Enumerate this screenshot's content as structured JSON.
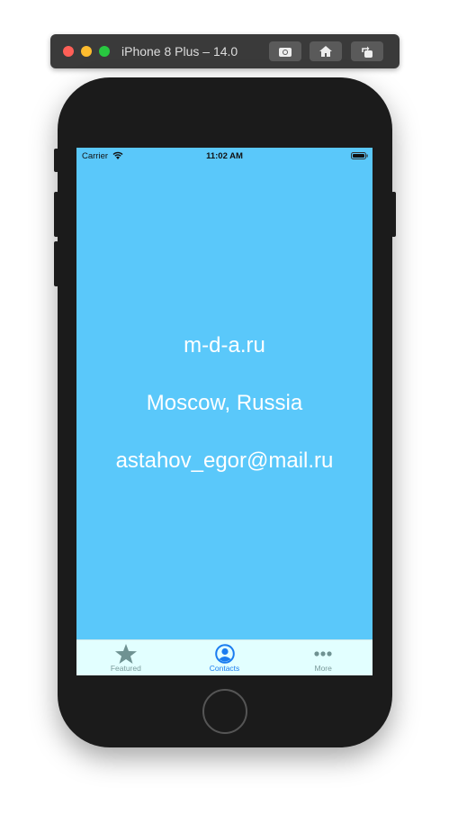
{
  "window": {
    "title": "iPhone 8 Plus – 14.0",
    "buttons": [
      "screenshot-icon",
      "home-icon",
      "rotate-icon"
    ]
  },
  "status_bar": {
    "carrier": "Carrier",
    "time": "11:02 AM"
  },
  "content": {
    "lines": [
      "m-d-a.ru",
      "Moscow, Russia",
      "astahov_egor@mail.ru"
    ]
  },
  "tab_bar": {
    "items": [
      {
        "label": "Featured",
        "icon": "star-icon"
      },
      {
        "label": "Contacts",
        "icon": "person-circle-icon",
        "selected": true
      },
      {
        "label": "More",
        "icon": "more-dots-icon"
      }
    ]
  },
  "colors": {
    "screen_bg": "#5AC8FA",
    "tab_bg": "#E2FFFF",
    "tab_active": "#1A7CF0",
    "tab_inactive": "#7A9A9A"
  }
}
